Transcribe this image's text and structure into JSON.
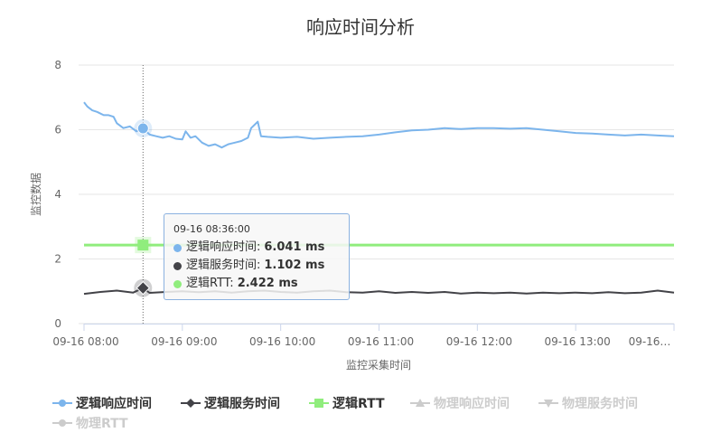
{
  "chart_data": {
    "type": "line",
    "title": "响应时间分析",
    "xlabel": "监控采集时间",
    "ylabel": "监控数据",
    "ylim": [
      0,
      8
    ],
    "yticks": [
      "0",
      "2",
      "4",
      "6",
      "8"
    ],
    "xticks": [
      "09-16 08:00",
      "09-16 09:00",
      "09-16 10:00",
      "09-16 11:00",
      "09-16 12:00",
      "09-16 13:00",
      "09-16…"
    ],
    "x_time_range": [
      "08:00",
      "14:00"
    ],
    "grid": true,
    "legend_position": "bottom-left",
    "series": [
      {
        "name": "逻辑响应时间",
        "color": "#7cb5ec",
        "marker": "circle",
        "visible": true,
        "points": [
          [
            "08:00",
            6.85
          ],
          [
            "08:02",
            6.72
          ],
          [
            "08:05",
            6.6
          ],
          [
            "08:08",
            6.55
          ],
          [
            "08:12",
            6.45
          ],
          [
            "08:15",
            6.45
          ],
          [
            "08:18",
            6.4
          ],
          [
            "08:20",
            6.2
          ],
          [
            "08:24",
            6.05
          ],
          [
            "08:28",
            6.1
          ],
          [
            "08:32",
            5.95
          ],
          [
            "08:36",
            6.04
          ],
          [
            "08:40",
            5.85
          ],
          [
            "08:44",
            5.8
          ],
          [
            "08:48",
            5.75
          ],
          [
            "08:52",
            5.8
          ],
          [
            "08:56",
            5.72
          ],
          [
            "09:00",
            5.7
          ],
          [
            "09:02",
            5.95
          ],
          [
            "09:05",
            5.75
          ],
          [
            "09:08",
            5.8
          ],
          [
            "09:12",
            5.6
          ],
          [
            "09:16",
            5.5
          ],
          [
            "09:20",
            5.55
          ],
          [
            "09:24",
            5.45
          ],
          [
            "09:28",
            5.55
          ],
          [
            "09:32",
            5.6
          ],
          [
            "09:36",
            5.65
          ],
          [
            "09:40",
            5.75
          ],
          [
            "09:42",
            6.05
          ],
          [
            "09:46",
            6.25
          ],
          [
            "09:48",
            5.8
          ],
          [
            "09:52",
            5.78
          ],
          [
            "10:00",
            5.75
          ],
          [
            "10:10",
            5.78
          ],
          [
            "10:20",
            5.72
          ],
          [
            "10:30",
            5.75
          ],
          [
            "10:40",
            5.78
          ],
          [
            "10:50",
            5.8
          ],
          [
            "11:00",
            5.85
          ],
          [
            "11:10",
            5.92
          ],
          [
            "11:20",
            5.98
          ],
          [
            "11:30",
            6.0
          ],
          [
            "11:40",
            6.05
          ],
          [
            "11:50",
            6.02
          ],
          [
            "12:00",
            6.05
          ],
          [
            "12:10",
            6.05
          ],
          [
            "12:20",
            6.03
          ],
          [
            "12:30",
            6.05
          ],
          [
            "12:40",
            6.0
          ],
          [
            "12:50",
            5.95
          ],
          [
            "13:00",
            5.9
          ],
          [
            "13:10",
            5.88
          ],
          [
            "13:20",
            5.85
          ],
          [
            "13:30",
            5.82
          ],
          [
            "13:40",
            5.85
          ],
          [
            "13:50",
            5.82
          ],
          [
            "14:00",
            5.8
          ]
        ]
      },
      {
        "name": "逻辑服务时间",
        "color": "#434348",
        "marker": "diamond",
        "visible": true,
        "points": [
          [
            "08:00",
            0.92
          ],
          [
            "08:10",
            0.98
          ],
          [
            "08:20",
            1.02
          ],
          [
            "08:30",
            0.96
          ],
          [
            "08:36",
            1.1
          ],
          [
            "08:40",
            0.95
          ],
          [
            "08:50",
            0.98
          ],
          [
            "09:00",
            1.0
          ],
          [
            "09:10",
            0.97
          ],
          [
            "09:20",
            1.0
          ],
          [
            "09:30",
            0.96
          ],
          [
            "09:40",
            1.0
          ],
          [
            "09:50",
            1.02
          ],
          [
            "10:00",
            0.98
          ],
          [
            "10:10",
            0.96
          ],
          [
            "10:20",
            1.0
          ],
          [
            "10:30",
            1.02
          ],
          [
            "10:40",
            0.97
          ],
          [
            "10:50",
            0.96
          ],
          [
            "11:00",
            1.0
          ],
          [
            "11:10",
            0.95
          ],
          [
            "11:20",
            0.98
          ],
          [
            "11:30",
            0.95
          ],
          [
            "11:40",
            0.98
          ],
          [
            "11:50",
            0.93
          ],
          [
            "12:00",
            0.96
          ],
          [
            "12:10",
            0.94
          ],
          [
            "12:20",
            0.96
          ],
          [
            "12:30",
            0.93
          ],
          [
            "12:40",
            0.96
          ],
          [
            "12:50",
            0.94
          ],
          [
            "13:00",
            0.96
          ],
          [
            "13:10",
            0.94
          ],
          [
            "13:20",
            0.97
          ],
          [
            "13:30",
            0.94
          ],
          [
            "13:40",
            0.96
          ],
          [
            "13:50",
            1.02
          ],
          [
            "14:00",
            0.96
          ]
        ]
      },
      {
        "name": "逻辑RTT",
        "color": "#90ed7d",
        "marker": "square",
        "visible": true,
        "points": [
          [
            "08:00",
            2.43
          ],
          [
            "09:00",
            2.43
          ],
          [
            "10:00",
            2.43
          ],
          [
            "11:00",
            2.43
          ],
          [
            "12:00",
            2.43
          ],
          [
            "13:00",
            2.43
          ],
          [
            "14:00",
            2.43
          ]
        ]
      },
      {
        "name": "物理响应时间",
        "color": "#cccccc",
        "marker": "triangle",
        "visible": false,
        "points": []
      },
      {
        "name": "物理服务时间",
        "color": "#cccccc",
        "marker": "triangle-down",
        "visible": false,
        "points": []
      },
      {
        "name": "物理RTT",
        "color": "#cccccc",
        "marker": "circle",
        "visible": false,
        "points": []
      }
    ],
    "crosshair_time": "08:36",
    "tooltip": {
      "header": "09-16 08:36:00",
      "rows": [
        {
          "label": "逻辑响应时间:",
          "value": "6.041 ms",
          "color": "#7cb5ec"
        },
        {
          "label": "逻辑服务时间:",
          "value": "1.102 ms",
          "color": "#434348"
        },
        {
          "label": "逻辑RTT:",
          "value": "2.422 ms",
          "color": "#90ed7d"
        }
      ]
    }
  }
}
